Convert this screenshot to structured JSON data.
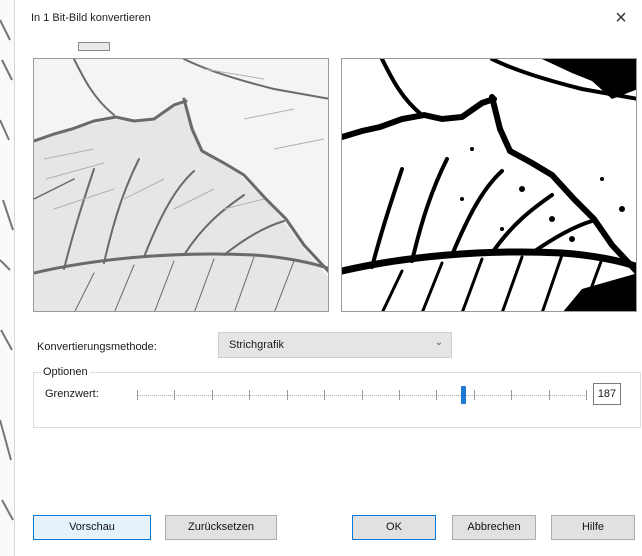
{
  "dialog": {
    "title": "In 1 Bit-Bild konvertieren",
    "close_label": "×"
  },
  "conversion": {
    "label": "Konvertierungsmethode:",
    "selected": "Strichgrafik"
  },
  "options": {
    "group_title": "Optionen",
    "threshold_label": "Grenzwert:",
    "threshold_value": "187",
    "threshold_max": 255
  },
  "buttons": {
    "preview": "Vorschau",
    "reset": "Zurücksetzen",
    "ok": "OK",
    "cancel": "Abbrechen",
    "help": "Hilfe"
  },
  "colors": {
    "accent": "#0078d7",
    "slider_thumb": "#1e78d6"
  }
}
